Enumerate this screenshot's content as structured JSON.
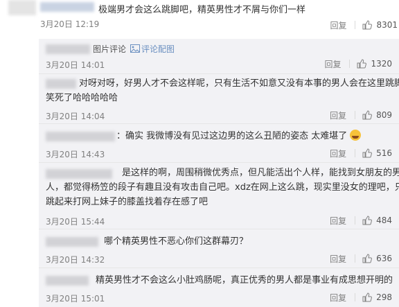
{
  "main_comment": {
    "text": "极端男才会这么跳脚吧，精英男性才不屑与你们一样",
    "date": "3月20日 12:19",
    "reply": "回复",
    "likes": "8301"
  },
  "replies": [
    {
      "prefix": "图片评论",
      "link_text": "评论配图",
      "date": "3月20日 14:01",
      "reply": "回复",
      "likes": "1320"
    },
    {
      "line1": "对呀对呀，好男人才不会这样呢，只有生活不如意又没有本事的男人会在这里跳脚，",
      "line2": "笑死了哈哈哈哈哈",
      "date": "3月20日 14:04",
      "reply": "回复",
      "likes": "809"
    },
    {
      "text": "：确实 我微博没有见过这边男的这么丑陋的姿态 太难堪了",
      "emoji": "grin-sweat-emoji",
      "date": "3月20日 14:43",
      "reply": "回复",
      "likes": "516"
    },
    {
      "line1": "是这样的啊，周围稍微优秀点，但凡能活出个人样，能找到女朋友的男",
      "line2": "人，都觉得杨笠的段子有趣且没有攻击自己吧。xdz在网上这么跳，现实里没女的理吧，只能",
      "line3": "跳起来打网上妹子的膝盖找着存在感了吧",
      "date": "3月20日 15:44",
      "reply": "回复",
      "likes": "484"
    },
    {
      "text": "哪个精英男性不恶心你们这群幕刃？",
      "date": "3月20日 14:32",
      "reply": "回复",
      "likes": "636"
    },
    {
      "text": "精英男性才不会这么小肚鸡肠呢，真正优秀的男人都是事业有成思想开明的",
      "date": "3月20日 15:01",
      "reply": "回复",
      "likes": "298"
    }
  ],
  "colors": {
    "sub_bg": "#f2f2f5",
    "link": "#6a8fc0",
    "muted": "#808080"
  },
  "icons": {
    "thumb": "thumb-up-icon",
    "picture": "picture-icon"
  }
}
